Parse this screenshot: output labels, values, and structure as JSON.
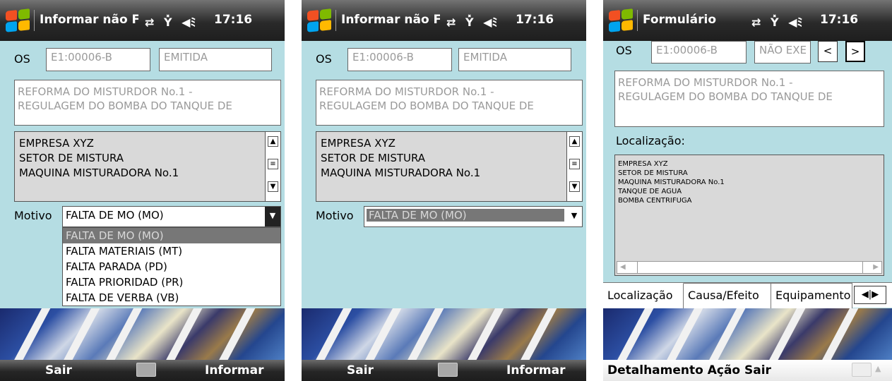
{
  "status": {
    "time": "17:16",
    "icons": [
      "sync-icon",
      "signal-off-icon",
      "volume-icon"
    ]
  },
  "screen1": {
    "title": "Informar não F",
    "os_label": "OS",
    "os_number": "E1:00006-B",
    "os_status": "EMITIDA",
    "description": [
      "REFORMA DO MISTURDOR No.1 -",
      "REGULAGEM DO BOMBA DO TANQUE DE"
    ],
    "location": [
      "EMPRESA XYZ",
      "SETOR DE MISTURA",
      "MAQUINA MISTURADORA No.1"
    ],
    "motivo_label": "Motivo",
    "motivo_value": "FALTA DE MO (MO)",
    "motivo_options": [
      "FALTA DE MO (MO)",
      "FALTA MATERIAIS (MT)",
      "FALTA PARADA (PD)",
      "FALTA PRIORIDAD (PR)",
      "FALTA DE VERBA (VB)"
    ],
    "left_soft": "Sair",
    "right_soft": "Informar"
  },
  "screen2": {
    "title": "Informar não F",
    "os_label": "OS",
    "os_number": "E1:00006-B",
    "os_status": "EMITIDA",
    "description": [
      "REFORMA DO MISTURDOR No.1 -",
      "REGULAGEM DO BOMBA DO TANQUE DE"
    ],
    "location": [
      "EMPRESA XYZ",
      "SETOR DE MISTURA",
      "MAQUINA MISTURADORA No.1"
    ],
    "motivo_label": "Motivo",
    "motivo_value": "FALTA DE MO (MO)",
    "left_soft": "Sair",
    "right_soft": "Informar"
  },
  "screen3": {
    "title": "Formulário",
    "os_label": "OS",
    "os_number": "E1:00006-B",
    "os_status": "NÃO EXE",
    "prev_label": "<",
    "next_label": ">",
    "description": [
      "REFORMA DO MISTURDOR No.1 -",
      "REGULAGEM DO BOMBA DO TANQUE DE"
    ],
    "localizacao_label": "Localização:",
    "location": [
      "EMPRESA XYZ",
      "SETOR DE MISTURA",
      "MAQUINA MISTURADORA No.1",
      "TANQUE DE AGUA",
      "BOMBA CENTRIFUGA"
    ],
    "tabs": [
      "Localização",
      "Causa/Efeito",
      "Equipamento"
    ],
    "menu": "Detalhamento Ação Sair"
  }
}
